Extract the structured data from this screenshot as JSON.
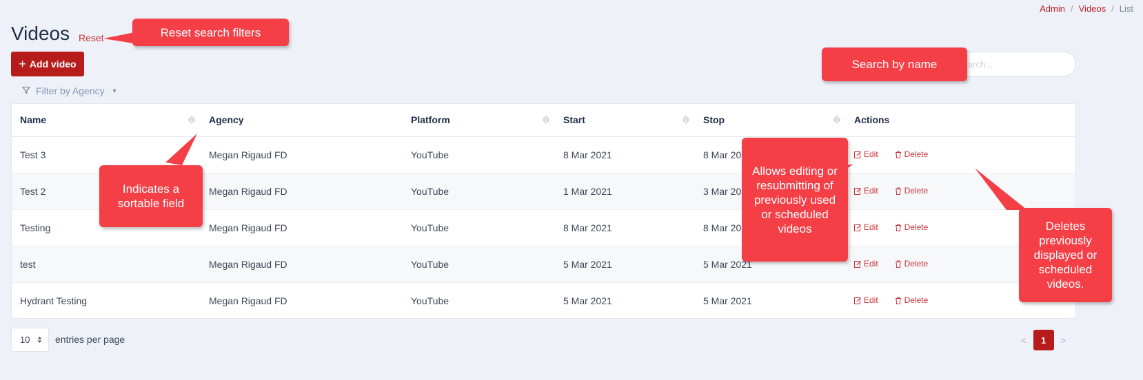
{
  "breadcrumb": {
    "items": [
      "Admin",
      "Videos"
    ],
    "current": "List"
  },
  "header": {
    "title": "Videos",
    "reset_label": "Reset",
    "add_button_label": "Add video"
  },
  "filter": {
    "label": "Filter by Agency"
  },
  "search": {
    "placeholder": "Search..."
  },
  "table": {
    "columns": [
      "Name",
      "Agency",
      "Platform",
      "Start",
      "Stop",
      "Actions"
    ],
    "action_labels": {
      "edit": "Edit",
      "delete": "Delete"
    },
    "rows": [
      {
        "name": "Test 3",
        "agency": "Megan Rigaud FD",
        "platform": "YouTube",
        "start": "8 Mar 2021",
        "stop": "8 Mar 2021"
      },
      {
        "name": "Test 2",
        "agency": "Megan Rigaud FD",
        "platform": "YouTube",
        "start": "1 Mar 2021",
        "stop": "3 Mar 2021"
      },
      {
        "name": "Testing",
        "agency": "Megan Rigaud FD",
        "platform": "YouTube",
        "start": "8 Mar 2021",
        "stop": "8 Mar 2021"
      },
      {
        "name": "test",
        "agency": "Megan Rigaud FD",
        "platform": "YouTube",
        "start": "5 Mar 2021",
        "stop": "5 Mar 2021"
      },
      {
        "name": "Hydrant Testing",
        "agency": "Megan Rigaud FD",
        "platform": "YouTube",
        "start": "5 Mar 2021",
        "stop": "5 Mar 2021"
      }
    ]
  },
  "footer": {
    "per_page_value": "10",
    "per_page_label": "entries per page",
    "pagination": {
      "prev": "<",
      "current": "1",
      "next": ">"
    }
  },
  "callouts": {
    "reset": "Reset search filters",
    "search": "Search by name",
    "sortable": "Indicates a sortable field",
    "edit": "Allows editing or resubmitting of previously used or scheduled videos",
    "delete": "Deletes previously displayed or scheduled videos."
  },
  "colors": {
    "brand": "#b71c1c",
    "callout": "#f43f47",
    "link": "#c9343a",
    "background": "#eef1f7"
  }
}
